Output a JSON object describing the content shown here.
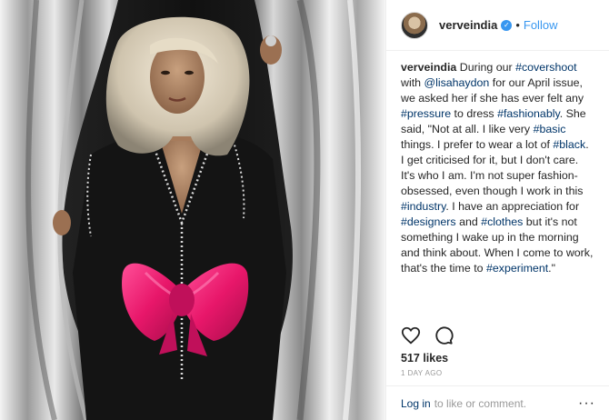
{
  "post": {
    "image_alt": "photo",
    "username": "verveindia",
    "follow_label": "Follow",
    "dot": "•",
    "caption_user": "verveindia",
    "caption_segments": [
      {
        "t": " During our ",
        "tag": false
      },
      {
        "t": "#covershoot",
        "tag": true
      },
      {
        "t": " with ",
        "tag": false
      },
      {
        "t": "@lisahaydon",
        "tag": true
      },
      {
        "t": " for our April issue, we asked her if she has ever felt any ",
        "tag": false
      },
      {
        "t": "#pressure",
        "tag": true
      },
      {
        "t": " to dress ",
        "tag": false
      },
      {
        "t": "#fashionably",
        "tag": true
      },
      {
        "t": ". She said, \"Not at all. I like very ",
        "tag": false
      },
      {
        "t": "#basic",
        "tag": true
      },
      {
        "t": " things. I prefer to wear a lot of ",
        "tag": false
      },
      {
        "t": "#black",
        "tag": true
      },
      {
        "t": ". I get criticised for it, but I don't care. It's who I am. I'm not super fashion-obsessed, even though I work in this ",
        "tag": false
      },
      {
        "t": "#industry",
        "tag": true
      },
      {
        "t": ". I have an appreciation for ",
        "tag": false
      },
      {
        "t": "#designers",
        "tag": true
      },
      {
        "t": " and ",
        "tag": false
      },
      {
        "t": "#clothes",
        "tag": true
      },
      {
        "t": " but it's not something I wake up in the morning and think about. When I come to work, that's the time to ",
        "tag": false
      },
      {
        "t": "#experiment",
        "tag": true
      },
      {
        "t": ".\"",
        "tag": false
      }
    ],
    "likes": "517 likes",
    "time": "1 DAY AGO",
    "login_label": "Log in",
    "comment_prompt": "to like or comment.",
    "more_label": "···"
  },
  "colors": {
    "link": "#003569",
    "accent": "#3897f0",
    "muted": "#999999",
    "bow": "#e8176a"
  },
  "icons": {
    "heart": "heart-icon",
    "comment": "comment-icon",
    "verified": "verified-badge-icon"
  }
}
